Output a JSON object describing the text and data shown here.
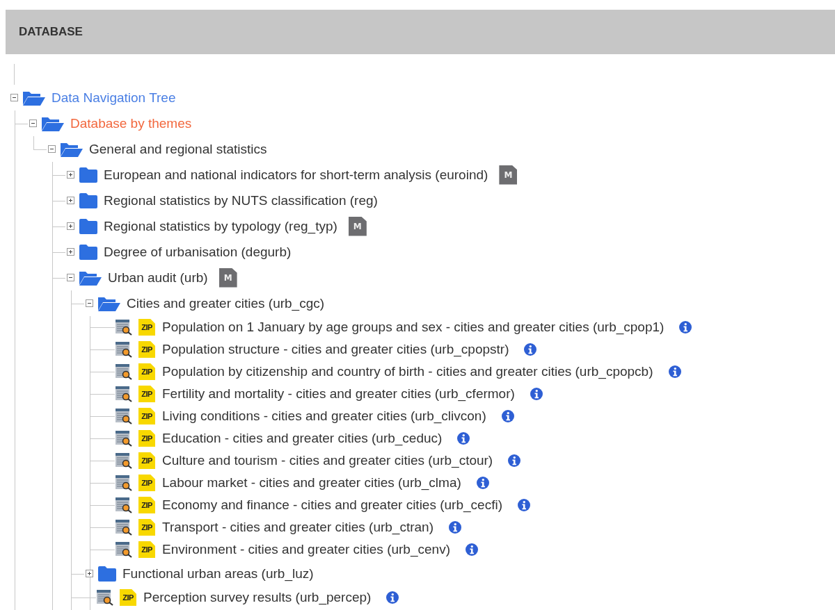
{
  "header": {
    "title": "DATABASE"
  },
  "tree": [
    {
      "kind": "folder",
      "label": "Data Navigation Tree",
      "selected": false,
      "expanded": true,
      "children": [
        {
          "kind": "folder",
          "label": "Database by themes",
          "selected": true,
          "expanded": true,
          "children": [
            {
              "kind": "folder",
              "label": "General and regional statistics",
              "selected": false,
              "expanded": true,
              "children": [
                {
                  "kind": "folder",
                  "label": "European and national indicators for short-term analysis (euroind)",
                  "selected": false,
                  "expanded": false,
                  "badge": "M"
                },
                {
                  "kind": "folder",
                  "label": "Regional statistics by NUTS classification (reg)",
                  "selected": false,
                  "expanded": false
                },
                {
                  "kind": "folder",
                  "label": "Regional statistics by typology (reg_typ)",
                  "selected": false,
                  "expanded": false,
                  "badge": "M"
                },
                {
                  "kind": "folder",
                  "label": "Degree of urbanisation (degurb)",
                  "selected": false,
                  "expanded": false
                },
                {
                  "kind": "folder",
                  "label": "Urban audit (urb)",
                  "selected": false,
                  "expanded": true,
                  "badge": "M",
                  "children": [
                    {
                      "kind": "folder",
                      "label": "Cities and greater cities (urb_cgc)",
                      "selected": false,
                      "expanded": true,
                      "children": [
                        {
                          "kind": "dataset",
                          "label": "Population on 1 January by age groups and sex - cities and greater cities (urb_cpop1)",
                          "selected": false,
                          "format": "ZIP"
                        },
                        {
                          "kind": "dataset",
                          "label": "Population structure - cities and greater cities (urb_cpopstr)",
                          "selected": false,
                          "format": "ZIP"
                        },
                        {
                          "kind": "dataset",
                          "label": "Population by citizenship and country of birth - cities and greater cities (urb_cpopcb)",
                          "selected": false,
                          "format": "ZIP"
                        },
                        {
                          "kind": "dataset",
                          "label": "Fertility and mortality - cities and greater cities (urb_cfermor)",
                          "selected": false,
                          "format": "ZIP"
                        },
                        {
                          "kind": "dataset",
                          "label": "Living conditions - cities and greater cities (urb_clivcon)",
                          "selected": false,
                          "format": "ZIP"
                        },
                        {
                          "kind": "dataset",
                          "label": "Education - cities and greater cities (urb_ceduc)",
                          "selected": false,
                          "format": "ZIP"
                        },
                        {
                          "kind": "dataset",
                          "label": "Culture and tourism - cities and greater cities (urb_ctour)",
                          "selected": false,
                          "format": "ZIP"
                        },
                        {
                          "kind": "dataset",
                          "label": "Labour market - cities and greater cities (urb_clma)",
                          "selected": false,
                          "format": "ZIP"
                        },
                        {
                          "kind": "dataset",
                          "label": "Economy and finance - cities and greater cities (urb_cecfi)",
                          "selected": false,
                          "format": "ZIP"
                        },
                        {
                          "kind": "dataset",
                          "label": "Transport - cities and greater cities (urb_ctran)",
                          "selected": false,
                          "format": "ZIP"
                        },
                        {
                          "kind": "dataset",
                          "label": "Environment - cities and greater cities (urb_cenv)",
                          "selected": false,
                          "format": "ZIP"
                        }
                      ]
                    },
                    {
                      "kind": "folder",
                      "label": "Functional urban areas (urb_luz)",
                      "selected": false,
                      "expanded": false
                    },
                    {
                      "kind": "dataset",
                      "label": "Perception survey results (urb_percep)",
                      "selected": false,
                      "format": "ZIP"
                    }
                  ]
                }
              ]
            }
          ]
        }
      ]
    }
  ]
}
